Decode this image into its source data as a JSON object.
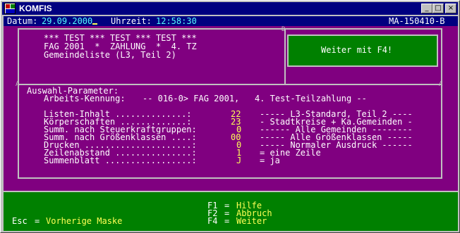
{
  "window": {
    "title": "KOMFIS",
    "controls": {
      "minimize": "_",
      "maximize": "□",
      "close": "×"
    }
  },
  "status_bar": {
    "date_label": "Datum:",
    "date_value": "29.09.2000",
    "time_label": "Uhrzeit:",
    "time_value": "12:58:30",
    "screen_id": "MA-150410-B"
  },
  "header": {
    "line1": "*** TEST *** TEST *** TEST ***",
    "line2": "FAG 2001  *  ZAHLUNG  *  4. TZ",
    "line3": "Gemeindeliste (L3, Teil 2)"
  },
  "continue_box": {
    "label": "Weiter mit F4!"
  },
  "params": {
    "heading": "Auswahl-Parameter:",
    "kennung_label": "Arbeits-Kennung:",
    "kennung_value": "-- 016-0> FAG 2001,   4. Test-Teilzahlung --",
    "rows": [
      {
        "label": "Listen-Inhalt ..............:",
        "value": "22",
        "desc": "----- L3-Standard, Teil 2 ----"
      },
      {
        "label": "Körperschaften .............:",
        "value": "23",
        "desc": "- Stadtkreise + Ka.Gemeinden -"
      },
      {
        "label": "Summ. nach Steuerkraftgruppen:",
        "value": "0",
        "desc": "------ Alle Gemeinden --------"
      },
      {
        "label": "Summ. nach Größenklassen ....:",
        "value": "00",
        "desc": "----- Alle Größenklassen -----"
      },
      {
        "label": "Drucken .....................:",
        "value": "0",
        "desc": "----- Normaler Ausdruck ------"
      },
      {
        "label": "Zeilenabstand ...............:",
        "value": "1",
        "desc": "= eine Zeile"
      },
      {
        "label": "Summenblatt .................:",
        "value": "J",
        "desc": "= ja"
      }
    ]
  },
  "footer": {
    "keys": [
      {
        "key": "F1",
        "action": "Hilfe"
      },
      {
        "key": "F2",
        "action": "Abbruch"
      },
      {
        "key": "F4",
        "action": "Weiter"
      }
    ],
    "esc_key": "Esc",
    "esc_action": "Vorherige Maske"
  },
  "frame_corner": {
    "top_mark": "D",
    "side_mark": "A"
  },
  "colors": {
    "console_bg": "#800080",
    "status_bg": "#000080",
    "footer_bg": "#008000",
    "text_main": "#ffffff",
    "text_value": "#ffff55",
    "text_accent": "#55ffff"
  }
}
